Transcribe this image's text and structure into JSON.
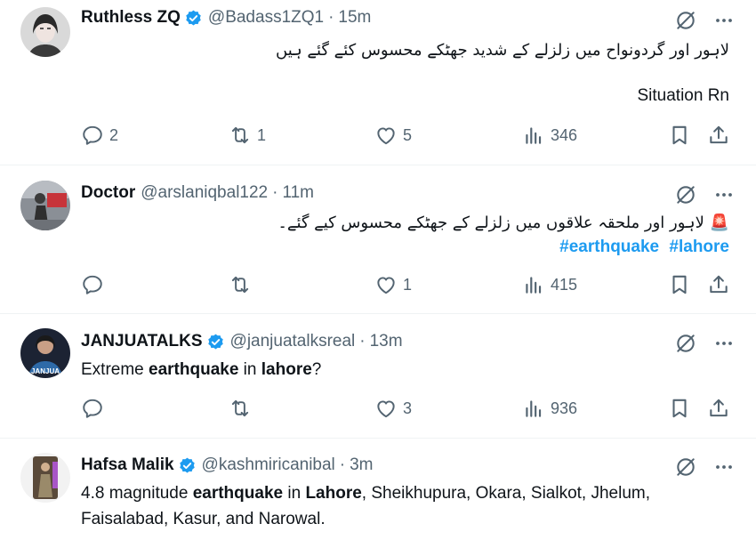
{
  "tweets": [
    {
      "name": "Ruthless ZQ",
      "verified": true,
      "handle": "@Badass1ZQ1",
      "time": "15m",
      "text_urdu": "لاہور اور گردونواح میں زلزلے کے شدید جھٹکے محسوس کئے گئے ہیں",
      "text_en": "Situation Rn",
      "replies": "2",
      "reposts": "1",
      "likes": "5",
      "views": "346"
    },
    {
      "name": "Doctor",
      "verified": false,
      "handle": "@arslaniqbal122",
      "time": "11m",
      "emoji": "🚨",
      "text_urdu": "لاہور اور ملحقہ علاقوں میں زلزلے کے جھٹکے محسوس کیے گئے۔",
      "hashtags": [
        "#earthquake",
        "#lahore"
      ],
      "replies": "",
      "reposts": "",
      "likes": "1",
      "views": "415"
    },
    {
      "name": "JANJUATALKS",
      "verified": true,
      "handle": "@janjuatalksreal",
      "time": "13m",
      "avatar_text": "JANJUA",
      "text_parts": [
        "Extreme ",
        "earthquake",
        " in ",
        "lahore",
        "?"
      ],
      "replies": "",
      "reposts": "",
      "likes": "3",
      "views": "936"
    },
    {
      "name": "Hafsa Malik",
      "verified": true,
      "handle": "@kashmiricanibal",
      "time": "3m",
      "text_parts": [
        "4.8 magnitude ",
        "earthquake",
        " in ",
        "Lahore",
        ", Sheikhupura, Okara, Sialkot, Jhelum, Faisalabad, Kasur, and Narowal."
      ]
    }
  ],
  "separator": "·",
  "icons": {
    "reply": "reply-icon",
    "repost": "repost-icon",
    "like": "heart-icon",
    "views": "views-chart-icon",
    "bookmark": "bookmark-icon",
    "share": "share-icon",
    "grok": "grok-icon",
    "more": "more-icon",
    "verified": "verified-badge-icon"
  },
  "colors": {
    "verified": "#1d9bf0",
    "hashtag": "#1d9bf0",
    "secondary": "#536471",
    "text": "#0f1419"
  }
}
